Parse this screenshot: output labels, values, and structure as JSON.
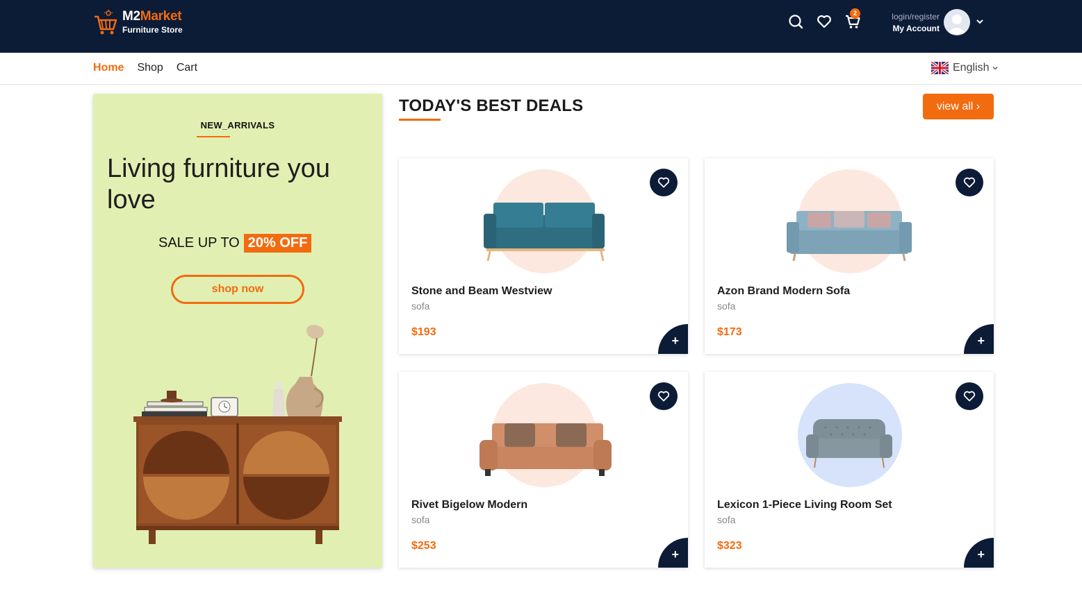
{
  "header": {
    "brand_part1": "M2",
    "brand_part2": "Market",
    "brand_sub": "Furniture Store",
    "cart_count": "2",
    "account_top": "login/register",
    "account_bottom": "My Account"
  },
  "nav": {
    "items": [
      {
        "label": "Home",
        "active": true
      },
      {
        "label": "Shop",
        "active": false
      },
      {
        "label": "Cart",
        "active": false
      }
    ],
    "language": "English"
  },
  "promo": {
    "tag": "NEW_ARRIVALS",
    "title": "Living furniture you love",
    "sale_text": "SALE UP TO",
    "sale_pct": "20% OFF",
    "button": "shop now"
  },
  "deals": {
    "title": "TODAY'S BEST DEALS",
    "view_all": "view all ›",
    "products": [
      {
        "name": "Stone and Beam Westview",
        "category": "sofa",
        "price": "$193"
      },
      {
        "name": "Azon Brand Modern Sofa",
        "category": "sofa",
        "price": "$173"
      },
      {
        "name": "Rivet Bigelow Modern",
        "category": "sofa",
        "price": "$253"
      },
      {
        "name": "Lexicon 1-Piece Living Room Set",
        "category": "sofa",
        "price": "$323"
      }
    ]
  },
  "colors": {
    "brand_orange": "#f26b0f",
    "navy": "#0c1b36",
    "promo_bg": "#e1f0b2",
    "circle_peach": "#fde8e0",
    "circle_blue": "#d7e3fb"
  }
}
